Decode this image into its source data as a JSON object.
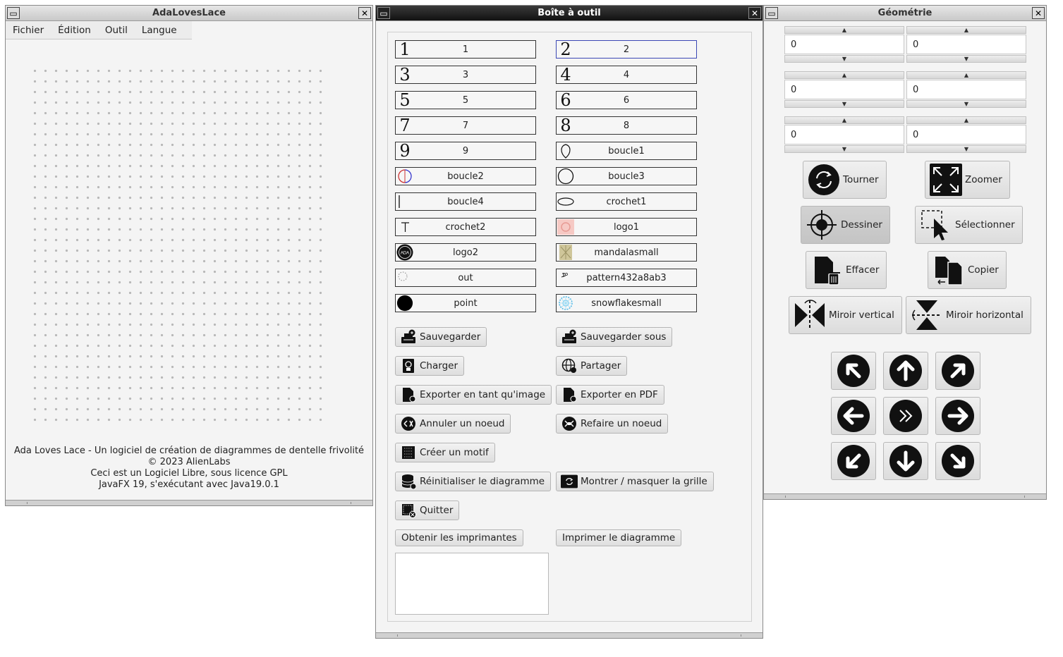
{
  "windows": {
    "main": {
      "title": "AdaLovesLace",
      "menu": [
        "Fichier",
        "Édition",
        "Outil",
        "Langue"
      ],
      "about": [
        "Ada Loves Lace - Un logiciel de création de diagrammes de dentelle frivolité",
        "© 2023 AlienLabs",
        "Ceci est un Logiciel Libre, sous licence GPL",
        "JavaFX 19, s'exécutant avec Java19.0.1"
      ]
    },
    "toolbox": {
      "title": "Boîte à outil",
      "glyphs": [
        {
          "label": "1",
          "icon": "digit-1"
        },
        {
          "label": "2",
          "icon": "digit-2",
          "selected": true
        },
        {
          "label": "3",
          "icon": "digit-3"
        },
        {
          "label": "4",
          "icon": "digit-4"
        },
        {
          "label": "5",
          "icon": "digit-5"
        },
        {
          "label": "6",
          "icon": "digit-6"
        },
        {
          "label": "7",
          "icon": "digit-7"
        },
        {
          "label": "8",
          "icon": "digit-8"
        },
        {
          "label": "9",
          "icon": "digit-9"
        },
        {
          "label": "boucle1",
          "icon": "loop-drop-icon"
        },
        {
          "label": "boucle2",
          "icon": "loop-red-blue-icon"
        },
        {
          "label": "boucle3",
          "icon": "circle-outline-icon"
        },
        {
          "label": "boucle4",
          "icon": "vertical-bar-icon"
        },
        {
          "label": "crochet1",
          "icon": "ellipse-icon"
        },
        {
          "label": "crochet2",
          "icon": "t-hook-icon"
        },
        {
          "label": "logo1",
          "icon": "pink-logo-icon"
        },
        {
          "label": "logo2",
          "icon": "ada-badge-icon"
        },
        {
          "label": "mandalasmall",
          "icon": "mandala-icon"
        },
        {
          "label": "out",
          "icon": "dotted-circle-icon"
        },
        {
          "label": "pattern432a8ab3",
          "icon": "pattern-icon"
        },
        {
          "label": "point",
          "icon": "filled-dot-icon"
        },
        {
          "label": "snowflakesmall",
          "icon": "snowflake-icon"
        }
      ],
      "actions": {
        "save": "Sauvegarder",
        "save_as": "Sauvegarder sous",
        "load": "Charger",
        "share": "Partager",
        "export_image": "Exporter en tant qu'image",
        "export_pdf": "Exporter en PDF",
        "undo": "Annuler un noeud",
        "redo": "Refaire un noeud",
        "create_motif": "Créer un motif",
        "reset": "Réinitialiser le diagramme",
        "toggle_grid": "Montrer / masquer la grille",
        "quit": "Quitter",
        "get_printers": "Obtenir les imprimantes",
        "print": "Imprimer le diagramme"
      }
    },
    "geometry": {
      "title": "Géométrie",
      "spinners": [
        "0",
        "0",
        "0",
        "0",
        "0",
        "0"
      ],
      "tools": {
        "rotate": "Tourner",
        "zoom": "Zoomer",
        "draw": "Dessiner",
        "select": "Sélectionner",
        "erase": "Effacer",
        "copy": "Copier",
        "mirror_v": "Miroir vertical",
        "mirror_h": "Miroir horizontal"
      },
      "nav_icons": [
        "arrow-up-left-icon",
        "arrow-up-icon",
        "arrow-up-right-icon",
        "arrow-left-icon",
        "fast-forward-center-icon",
        "arrow-right-icon",
        "arrow-down-left-icon",
        "arrow-down-icon",
        "arrow-down-right-icon"
      ]
    }
  }
}
